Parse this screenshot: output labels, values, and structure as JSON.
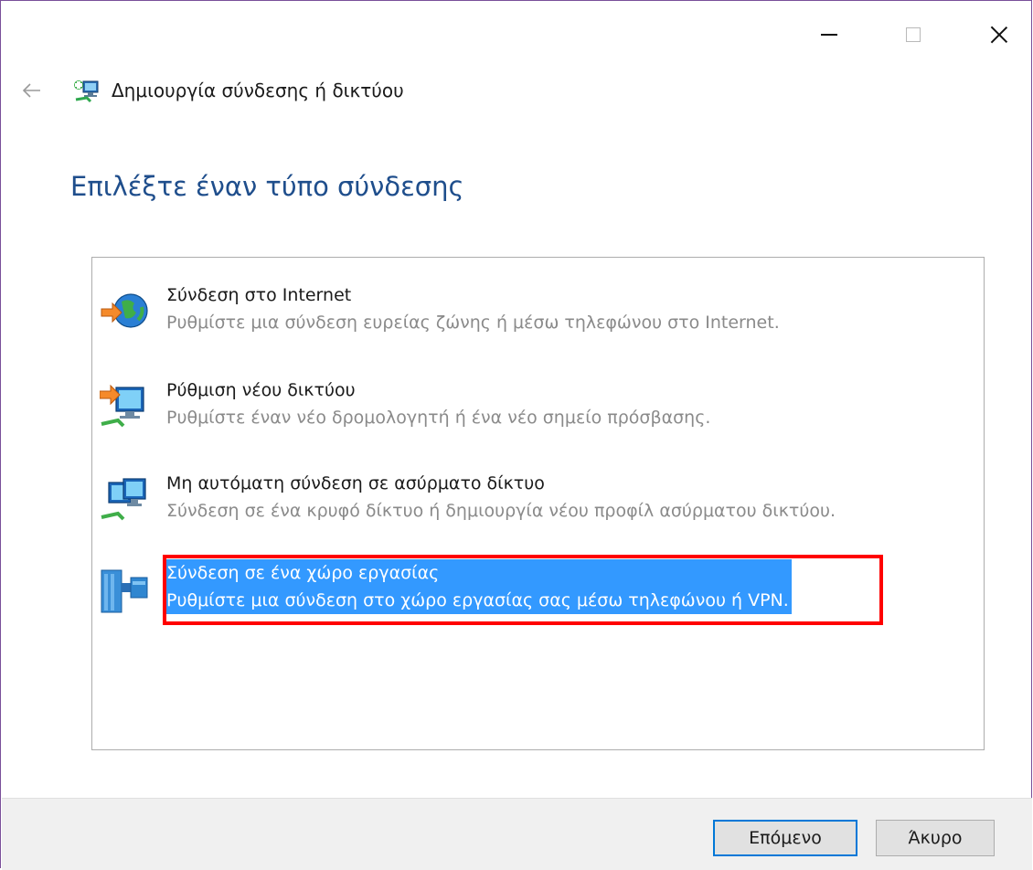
{
  "window": {
    "title": "Δημιουργία σύνδεσης ή δικτύου"
  },
  "heading": "Επιλέξτε έναν τύπο σύνδεσης",
  "options": [
    {
      "title": "Σύνδεση στο Internet",
      "description": "Ρυθμίστε μια σύνδεση ευρείας ζώνης ή μέσω τηλεφώνου στο Internet.",
      "icon": "globe-icon",
      "selected": false
    },
    {
      "title": "Ρύθμιση νέου δικτύου",
      "description": "Ρυθμίστε έναν νέο δρομολογητή ή ένα νέο σημείο πρόσβασης.",
      "icon": "new-network-icon",
      "selected": false
    },
    {
      "title": "Μη αυτόματη σύνδεση σε ασύρματο δίκτυο",
      "description": "Σύνδεση σε ένα κρυφό δίκτυο ή δημιουργία νέου προφίλ ασύρματου δικτύου.",
      "icon": "wireless-network-icon",
      "selected": false
    },
    {
      "title": "Σύνδεση σε ένα χώρο εργασίας",
      "description": "Ρυθμίστε μια σύνδεση στο χώρο εργασίας σας μέσω τηλεφώνου ή VPN.",
      "icon": "workplace-icon",
      "selected": true
    }
  ],
  "buttons": {
    "next": "Επόμενο",
    "cancel": "Άκυρο"
  },
  "colors": {
    "heading": "#1f4e8c",
    "selection": "#3399ff",
    "highlight_frame": "#ff0000",
    "default_button_border": "#0078d7"
  }
}
